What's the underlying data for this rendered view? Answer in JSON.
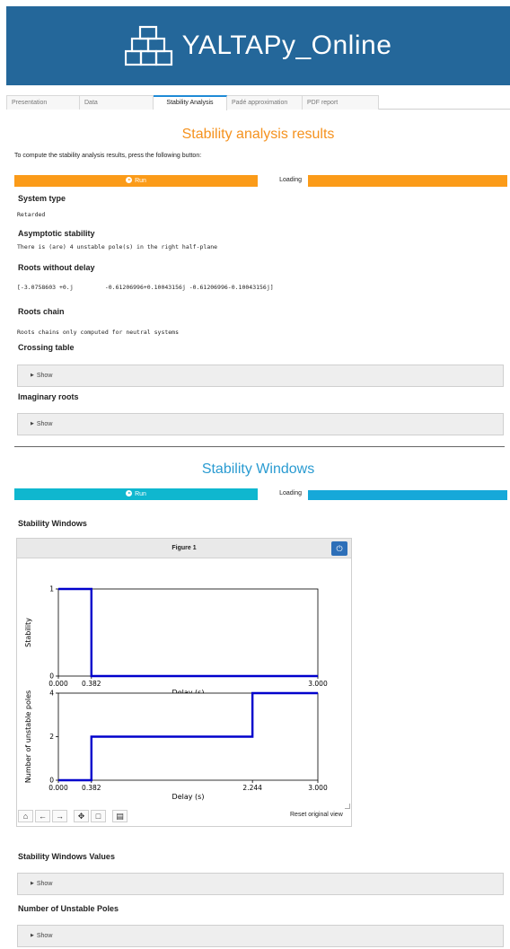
{
  "banner": {
    "title": "YALTAPy_Online",
    "logo_icon": "stacked-boxes-logo-icon",
    "color": "#24679a"
  },
  "tabs": [
    {
      "label": "Presentation",
      "active": false
    },
    {
      "label": "Data",
      "active": false
    },
    {
      "label": "Stability Analysis",
      "active": true
    },
    {
      "label": "Padé approximation",
      "active": false
    },
    {
      "label": "PDF report",
      "active": false
    }
  ],
  "stability_results": {
    "title": "Stability analysis results",
    "intro": "To compute the stability analysis results, press the following button:",
    "run_label": "Run",
    "loading_label": "Loading",
    "system_type_heading": "System type",
    "system_type_value": "Retarded",
    "asymptotic_heading": "Asymptotic stability",
    "asymptotic_value": "There is (are) 4 unstable pole(s) in the right half-plane",
    "roots_wo_delay_heading": "Roots without delay",
    "roots_wo_delay_value": "[-3.0758603 +0.j         -0.61206996+0.10043156j -0.61206996-0.10043156j]",
    "roots_chain_heading": "Roots chain",
    "roots_chain_value": "Roots chains only computed for neutral systems",
    "crossing_heading": "Crossing table",
    "crossing_show": "Show",
    "imaginary_heading": "Imaginary roots",
    "imaginary_show": "Show"
  },
  "stability_windows": {
    "title": "Stability Windows",
    "run_label": "Run",
    "loading_label": "Loading",
    "subheading": "Stability Windows",
    "figure_title": "Figure 1",
    "reset_label": "Reset original view",
    "toolbar_icons": [
      "home-icon",
      "back-arrow-icon",
      "forward-arrow-icon",
      "pan-icon",
      "zoom-rect-icon",
      "save-icon"
    ],
    "values_heading": "Stability Windows Values",
    "values_show": "Show",
    "unstable_heading": "Number of Unstable Poles",
    "unstable_show": "Show"
  },
  "chart_data": [
    {
      "type": "line",
      "step": true,
      "xlabel": "Delay (s)",
      "ylabel": "Stability",
      "xlim": [
        0,
        3
      ],
      "ylim": [
        0,
        1
      ],
      "xticks": [
        "0.000",
        "0.382",
        "3.000"
      ],
      "yticks": [
        "0",
        "1"
      ],
      "series": [
        {
          "x": [
            0,
            0.382,
            0.382,
            3.0
          ],
          "y": [
            1,
            1,
            0,
            0
          ],
          "color": "#0000cc"
        }
      ]
    },
    {
      "type": "line",
      "step": true,
      "xlabel": "Delay (s)",
      "ylabel": "Number of unstable poles",
      "xlim": [
        0,
        3
      ],
      "ylim": [
        0,
        4
      ],
      "xticks": [
        "0.000",
        "0.382",
        "2.244",
        "3.000"
      ],
      "yticks": [
        "0",
        "2",
        "4"
      ],
      "series": [
        {
          "x": [
            0,
            0.382,
            0.382,
            2.244,
            2.244,
            3.0
          ],
          "y": [
            0,
            0,
            2,
            2,
            4,
            4
          ],
          "color": "#0000cc"
        }
      ]
    }
  ],
  "colors": {
    "orange": "#f5921e",
    "run_orange": "#fb9b19",
    "run_teal": "#0fb7cf",
    "loading_blue": "#16a8d9",
    "title_blue": "#2a9bd1"
  }
}
